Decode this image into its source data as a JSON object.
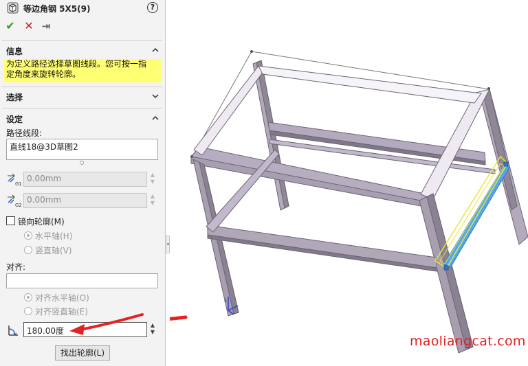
{
  "window": {
    "title": "等边角钢 5X5(9)"
  },
  "actions": {
    "ok": "✔",
    "cancel": "✕",
    "pin": "⇥"
  },
  "help": "?",
  "sections": {
    "info": {
      "title": "信息",
      "message_line1": "为定义路径选择草图线段。您可按一指",
      "message_line2": "定角度来旋转轮廓。"
    },
    "selection": {
      "title": "选择"
    },
    "settings": {
      "title": "设定",
      "path_label": "路径线段:",
      "path_value": "直线18@3D草图2",
      "offset1": "0.00mm",
      "offset1_tag": "G1",
      "offset2": "0.00mm",
      "offset2_tag": "G2",
      "mirror_label": "镜向轮廓(M)",
      "horizontal_axis": "水平轴(H)",
      "vertical_axis": "竖直轴(V)",
      "align_label": "对齐:",
      "align_value": "",
      "align_horizontal": "对齐水平轴(O)",
      "align_vertical": "对齐竖直轴(E)",
      "angle_value": "180.00度",
      "find_profile": "找出轮廓(L)"
    }
  },
  "watermark": "maoliangcat.com",
  "colors": {
    "info_bg": "#ffff73",
    "ok": "#2b9a2b",
    "cancel": "#c81e1e",
    "frame_face": "#b7adc0",
    "frame_dark": "#6f6877",
    "highlight_yellow": "#ffff3a",
    "highlight_blue": "#54a6ee",
    "arrow_red": "#e52222",
    "watermark": "#e02020"
  }
}
